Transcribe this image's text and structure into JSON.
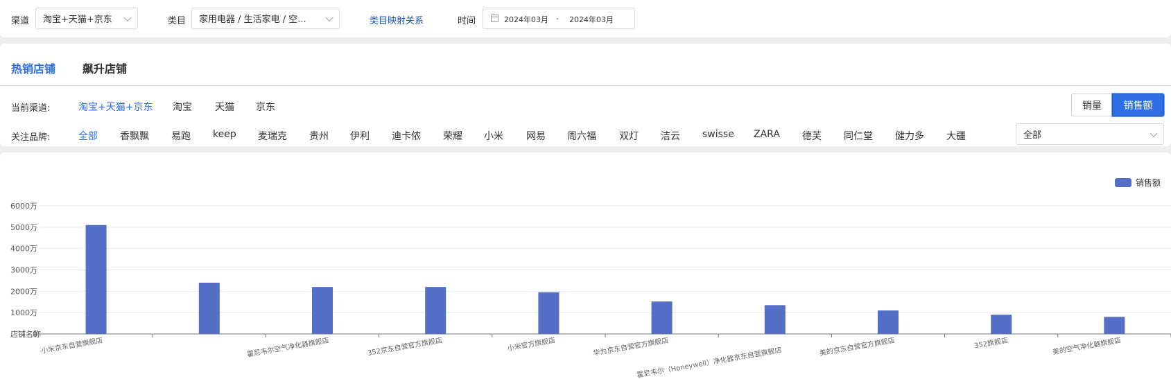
{
  "filters": {
    "channel_label": "渠道",
    "channel_value": "淘宝+天猫+京东",
    "category_label": "类目",
    "category_value": "家用电器 / 生活家电 / 空...",
    "mapping_link": "类目映射关系",
    "time_label": "时间",
    "date_start": "2024年03月",
    "date_sep": "-",
    "date_end": "2024年03月"
  },
  "tabs": [
    {
      "label": "热销店铺",
      "active": true
    },
    {
      "label": "飙升店铺",
      "active": false
    }
  ],
  "channel_row": {
    "label": "当前渠道:",
    "items": [
      {
        "label": "淘宝+天猫+京东",
        "active": true
      },
      {
        "label": "淘宝",
        "active": false
      },
      {
        "label": "天猫",
        "active": false
      },
      {
        "label": "京东",
        "active": false
      }
    ]
  },
  "brand_row": {
    "label": "关注品牌:",
    "items": [
      {
        "label": "全部",
        "active": true
      },
      {
        "label": "香飘飘"
      },
      {
        "label": "易跑"
      },
      {
        "label": "keep"
      },
      {
        "label": "麦瑞克"
      },
      {
        "label": "贵州"
      },
      {
        "label": "伊利"
      },
      {
        "label": "迪卡侬"
      },
      {
        "label": "荣耀"
      },
      {
        "label": "小米"
      },
      {
        "label": "网易"
      },
      {
        "label": "周六福"
      },
      {
        "label": "双灯"
      },
      {
        "label": "洁云"
      },
      {
        "label": "swisse"
      },
      {
        "label": "ZARA"
      },
      {
        "label": "德芙"
      },
      {
        "label": "同仁堂"
      },
      {
        "label": "健力多"
      },
      {
        "label": "大疆"
      }
    ],
    "select_value": "全部"
  },
  "metric_toggle": {
    "volume_label": "销量",
    "amount_label": "销售额",
    "selected": "销售额"
  },
  "chart_data": {
    "type": "bar",
    "legend": "销售额",
    "legend_position": "top-right",
    "color": "#5470c6",
    "y_axis_name": "店铺名称",
    "ylim": [
      0,
      60000000
    ],
    "yticks": [
      {
        "value": 0,
        "label": "0"
      },
      {
        "value": 10000000,
        "label": "1000万"
      },
      {
        "value": 20000000,
        "label": "2000万"
      },
      {
        "value": 30000000,
        "label": "3000万"
      },
      {
        "value": 40000000,
        "label": "4000万"
      },
      {
        "value": 50000000,
        "label": "5000万"
      },
      {
        "value": 60000000,
        "label": "6000万"
      }
    ],
    "categories": [
      "小米京东自营旗舰店",
      "",
      "霍尼韦尔空气净化器旗舰店",
      "352京东自营官方旗舰店",
      "小米官方旗舰店",
      "华为京东自营官方旗舰店",
      "霍尼韦尔（Honeywell）净化器京东自营旗舰店",
      "美的京东自营官方旗舰店",
      "352旗舰店",
      "美的空气净化器旗舰店"
    ],
    "values": [
      51000000,
      24000000,
      22000000,
      22000000,
      19500000,
      15200000,
      13500000,
      11000000,
      9000000,
      8000000
    ],
    "grid": true
  }
}
